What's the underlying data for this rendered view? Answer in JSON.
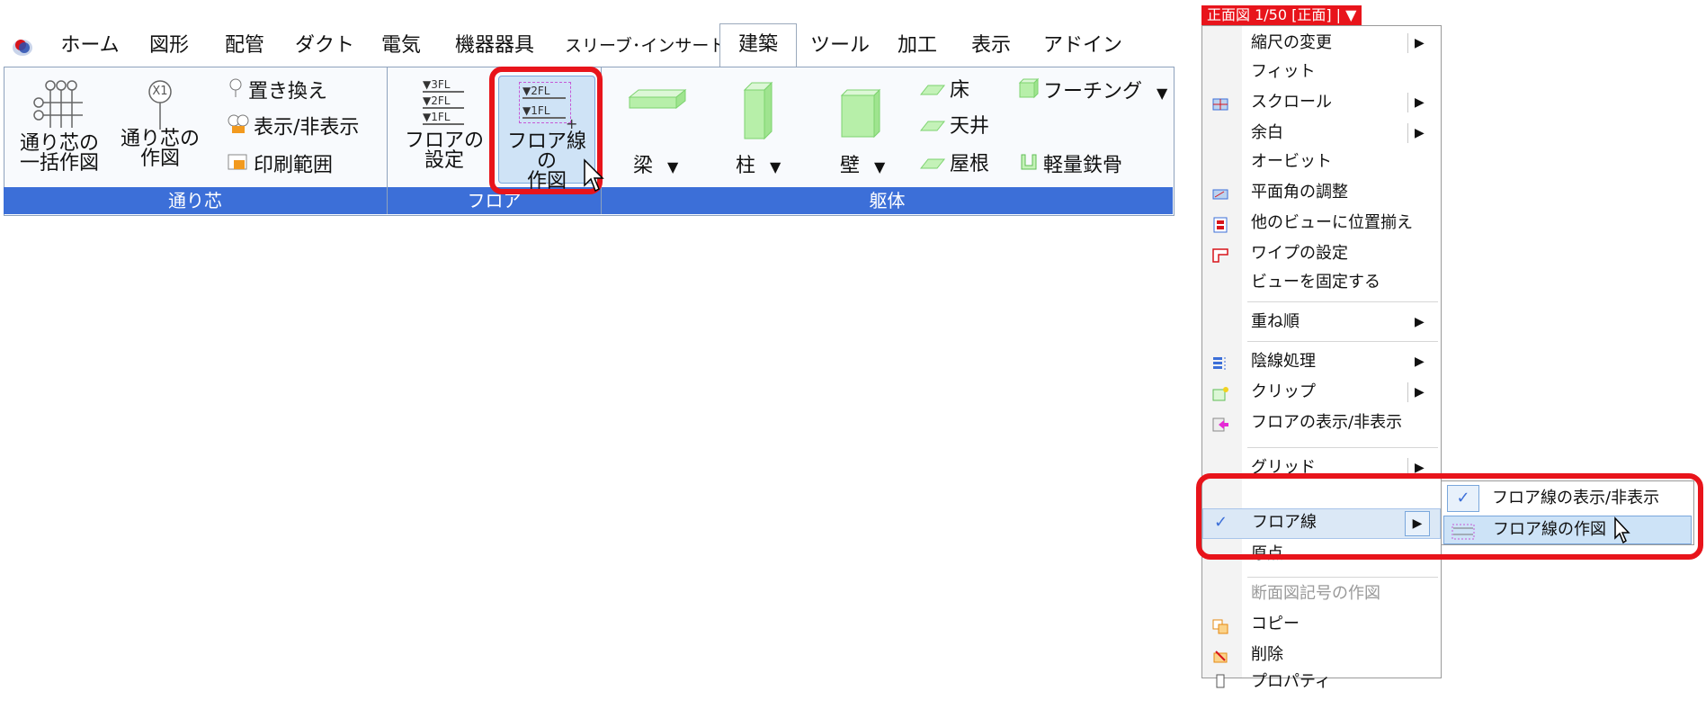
{
  "tabs": [
    "ホーム",
    "図形",
    "配管",
    "ダクト",
    "電気",
    "機器器具",
    "スリーブ･インサート",
    "建築",
    "ツール",
    "加工",
    "表示",
    "アドイン"
  ],
  "active_tab": "建築",
  "ribbon": {
    "groups": [
      "通り芯",
      "フロア",
      "躯体"
    ],
    "grid_batch": "通り芯の\n一括作図",
    "grid_draw": "通り芯の\n作図",
    "grid_badge": "X1",
    "replace": "置き換え",
    "show_hide": "表示/非表示",
    "print_range": "印刷範囲",
    "floor_setting": "フロアの\n設定",
    "floor_line_draw": "フロア線の\n作図",
    "floor_icon_labels": [
      "▼3FL",
      "▼2FL",
      "▼1FL"
    ],
    "floor_line_icon_labels": [
      "▼2FL",
      "▼1FL"
    ],
    "beam": "梁",
    "column": "柱",
    "wall": "壁",
    "floor": "床",
    "ceiling": "天井",
    "roof": "屋根",
    "footing": "フーチング",
    "light_steel": "軽量鉄骨",
    "dropdown_arrow": "▼",
    "plus": "+"
  },
  "view_tab": "正面図 1/50 [正面] | ▼",
  "context_menu": {
    "items": [
      {
        "label": "縮尺の変更",
        "arrow": "▶",
        "icon": "none"
      },
      {
        "label": "フィット",
        "arrow": "",
        "icon": "none"
      },
      {
        "label": "スクロール",
        "arrow": "▶",
        "icon": "scroll-icon"
      },
      {
        "label": "余白",
        "arrow": "▶",
        "icon": "none"
      },
      {
        "label": "オービット",
        "arrow": "",
        "icon": "none"
      },
      {
        "label": "平面角の調整",
        "arrow": "",
        "icon": "angle-icon"
      },
      {
        "label": "他のビューに位置揃え",
        "arrow": "",
        "icon": "align-icon"
      },
      {
        "label": "ワイプの設定",
        "arrow": "",
        "icon": "wipe-icon"
      },
      {
        "label": "ビューを固定する",
        "arrow": "",
        "icon": "none"
      },
      {
        "label": "重ね順",
        "arrow": "▶",
        "icon": "none"
      },
      {
        "label": "陰線処理",
        "arrow": "▶",
        "icon": "hidden-line-icon"
      },
      {
        "label": "クリップ",
        "arrow": "▶",
        "icon": "clip-icon"
      },
      {
        "label": "フロアの表示/非表示",
        "arrow": "",
        "icon": "floor-visibility-icon"
      },
      {
        "label": "グリッド",
        "arrow": "▶",
        "icon": "none"
      },
      {
        "label": "フロア線",
        "arrow": "▶",
        "icon": "check-icon"
      },
      {
        "label": "原点",
        "arrow": "",
        "icon": "none"
      },
      {
        "label": "断面図記号の作図",
        "arrow": "",
        "icon": "none",
        "disabled": true
      },
      {
        "label": "コピー",
        "arrow": "",
        "icon": "copy-icon"
      },
      {
        "label": "削除",
        "arrow": "",
        "icon": "delete-icon"
      },
      {
        "label": "プロパティ",
        "arrow": "",
        "icon": "properties-icon"
      }
    ],
    "check_mark": "✓"
  },
  "submenu": {
    "items": [
      {
        "label": "フロア線の表示/非表示",
        "icon": "check-icon"
      },
      {
        "label": "フロア線の作図",
        "icon": "floor-line-draw-icon"
      }
    ]
  },
  "colors": {
    "accent_red": "#e8141b",
    "group_bar_blue": "#3c6fd8",
    "selection_blue": "#cde3f7"
  }
}
